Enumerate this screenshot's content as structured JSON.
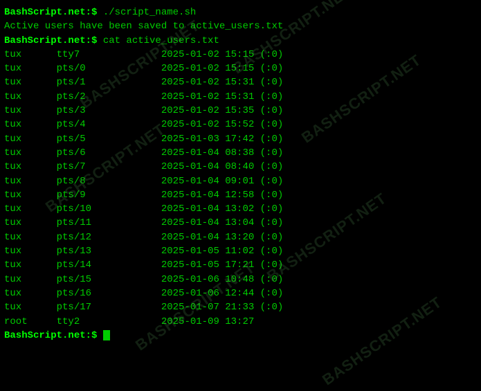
{
  "terminal": {
    "background": "#000000",
    "text_color": "#00cc00",
    "prompt_color": "#00ff00",
    "prompt": "BashScript.net:$",
    "lines": [
      {
        "type": "prompt_cmd",
        "prompt": "BashScript.net:$",
        "cmd": " ./script_name.sh"
      },
      {
        "type": "output",
        "text": "Active users have been saved to active_users.txt"
      },
      {
        "type": "prompt_cmd",
        "prompt": "BashScript.net:$",
        "cmd": " cat active_users.txt"
      },
      {
        "type": "data",
        "col1": "tux",
        "col2": "tty7",
        "col3": "2025-01-02",
        "col4": "15:15",
        "col5": "(:0)"
      },
      {
        "type": "data",
        "col1": "tux",
        "col2": "pts/0",
        "col3": "2025-01-02",
        "col4": "15:15",
        "col5": "(:0)"
      },
      {
        "type": "data",
        "col1": "tux",
        "col2": "pts/1",
        "col3": "2025-01-02",
        "col4": "15:31",
        "col5": "(:0)"
      },
      {
        "type": "data",
        "col1": "tux",
        "col2": "pts/2",
        "col3": "2025-01-02",
        "col4": "15:31",
        "col5": "(:0)"
      },
      {
        "type": "data",
        "col1": "tux",
        "col2": "pts/3",
        "col3": "2025-01-02",
        "col4": "15:35",
        "col5": "(:0)"
      },
      {
        "type": "data",
        "col1": "tux",
        "col2": "pts/4",
        "col3": "2025-01-02",
        "col4": "15:52",
        "col5": "(:0)"
      },
      {
        "type": "data",
        "col1": "tux",
        "col2": "pts/5",
        "col3": "2025-01-03",
        "col4": "17:42",
        "col5": "(:0)"
      },
      {
        "type": "data",
        "col1": "tux",
        "col2": "pts/6",
        "col3": "2025-01-04",
        "col4": "08:38",
        "col5": "(:0)"
      },
      {
        "type": "data",
        "col1": "tux",
        "col2": "pts/7",
        "col3": "2025-01-04",
        "col4": "08:40",
        "col5": "(:0)"
      },
      {
        "type": "data",
        "col1": "tux",
        "col2": "pts/8",
        "col3": "2025-01-04",
        "col4": "09:01",
        "col5": "(:0)"
      },
      {
        "type": "data",
        "col1": "tux",
        "col2": "pts/9",
        "col3": "2025-01-04",
        "col4": "12:58",
        "col5": "(:0)"
      },
      {
        "type": "data",
        "col1": "tux",
        "col2": "pts/10",
        "col3": "2025-01-04",
        "col4": "13:02",
        "col5": "(:0)"
      },
      {
        "type": "data",
        "col1": "tux",
        "col2": "pts/11",
        "col3": "2025-01-04",
        "col4": "13:04",
        "col5": "(:0)"
      },
      {
        "type": "data",
        "col1": "tux",
        "col2": "pts/12",
        "col3": "2025-01-04",
        "col4": "13:20",
        "col5": "(:0)"
      },
      {
        "type": "data",
        "col1": "tux",
        "col2": "pts/13",
        "col3": "2025-01-05",
        "col4": "11:02",
        "col5": "(:0)"
      },
      {
        "type": "data",
        "col1": "tux",
        "col2": "pts/14",
        "col3": "2025-01-05",
        "col4": "17:21",
        "col5": "(:0)"
      },
      {
        "type": "data",
        "col1": "tux",
        "col2": "pts/15",
        "col3": "2025-01-06",
        "col4": "10:48",
        "col5": "(:0)"
      },
      {
        "type": "data",
        "col1": "tux",
        "col2": "pts/16",
        "col3": "2025-01-06",
        "col4": "12:44",
        "col5": "(:0)"
      },
      {
        "type": "data",
        "col1": "tux",
        "col2": "pts/17",
        "col3": "2025-01-07",
        "col4": "21:33",
        "col5": "(:0)"
      },
      {
        "type": "data",
        "col1": "root",
        "col2": "tty2",
        "col3": "2025-01-09",
        "col4": "13:27",
        "col5": ""
      },
      {
        "type": "prompt_cursor",
        "prompt": "BashScript.net:$"
      }
    ],
    "watermark": "BASHSCRIPT.NET"
  }
}
